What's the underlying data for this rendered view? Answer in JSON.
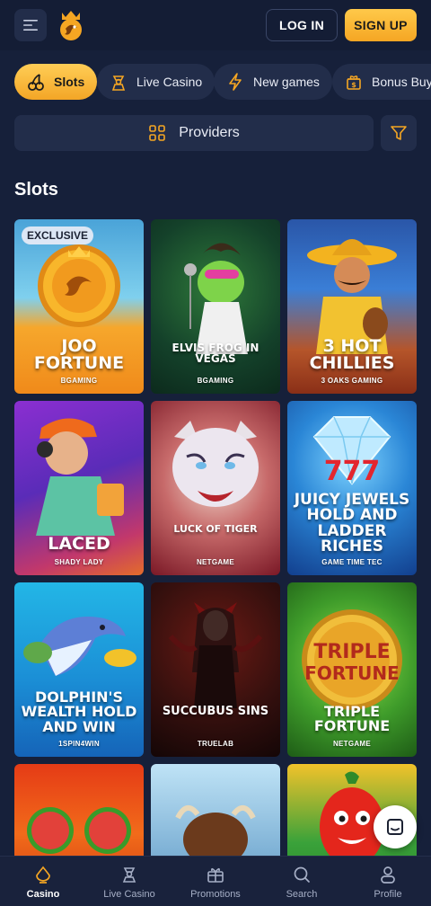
{
  "header": {
    "menu_icon": "menu-icon",
    "logo_icon": "joo-logo",
    "login_label": "LOG IN",
    "signup_label": "SIGN UP"
  },
  "tabs": [
    {
      "label": "Slots",
      "icon": "cherries-icon",
      "active": true
    },
    {
      "label": "Live Casino",
      "icon": "dealer-icon",
      "active": false
    },
    {
      "label": "New games",
      "icon": "lightning-icon",
      "active": false
    },
    {
      "label": "Bonus Buy",
      "icon": "gift-dollar-icon",
      "active": false
    }
  ],
  "providers_label": "Providers",
  "section_title": "Slots",
  "games": [
    {
      "title": "JOO FORTUNE",
      "provider": "BGAMING",
      "badge": "EXCLUSIVE"
    },
    {
      "title": "ELVIS FROG IN VEGAS",
      "provider": "BGAMING"
    },
    {
      "title": "3 HOT CHILLIES",
      "provider": "3 OAKS GAMING"
    },
    {
      "title": "LACED",
      "provider": "SHADY LADY"
    },
    {
      "title": "LUCK OF TIGER",
      "provider": "NETGAME"
    },
    {
      "title": "JUICY JEWELS HOLD AND LADDER RICHES",
      "provider": "GAME TIME TEC"
    },
    {
      "title": "DOLPHIN'S WEALTH HOLD AND WIN",
      "provider": "1SPIN4WIN"
    },
    {
      "title": "SUCCUBUS SINS",
      "provider": "TRUELAB"
    },
    {
      "title": "TRIPLE FORTUNE",
      "provider": "NETGAME"
    }
  ],
  "bottom_nav": [
    {
      "label": "Casino",
      "icon": "casino-icon",
      "active": true
    },
    {
      "label": "Live Casino",
      "icon": "dealer-icon",
      "active": false
    },
    {
      "label": "Promotions",
      "icon": "gift-icon",
      "active": false
    },
    {
      "label": "Search",
      "icon": "search-icon",
      "active": false
    },
    {
      "label": "Profile",
      "icon": "user-icon",
      "active": false
    }
  ],
  "colors": {
    "background": "#16203a",
    "surface": "#222d4a",
    "accent": "#f5a623"
  }
}
